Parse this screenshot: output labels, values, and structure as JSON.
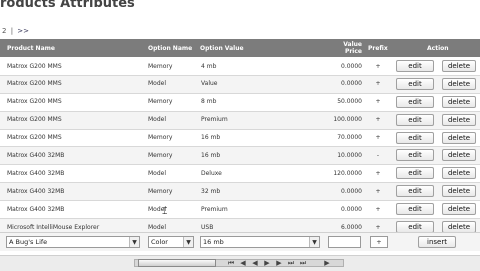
{
  "page": {
    "title": "roducts Attributes"
  },
  "pager": {
    "current": "2",
    "separator": "|",
    "next": ">>"
  },
  "table": {
    "headers": {
      "product_name": "Product Name",
      "option_name": "Option Name",
      "option_value": "Option Value",
      "value_price_line1": "Value",
      "value_price_line2": "Price",
      "prefix": "Prefix",
      "action": "Action"
    },
    "edit_label": "edit",
    "delete_label": "delete",
    "rows": [
      {
        "product": "Matrox G200 MMS",
        "option": "Memory",
        "value": "4 mb",
        "price": "0.0000",
        "prefix": "+"
      },
      {
        "product": "Matrox G200 MMS",
        "option": "Model",
        "value": "Value",
        "price": "0.0000",
        "prefix": "+"
      },
      {
        "product": "Matrox G200 MMS",
        "option": "Memory",
        "value": "8 mb",
        "price": "50.0000",
        "prefix": "+"
      },
      {
        "product": "Matrox G200 MMS",
        "option": "Model",
        "value": "Premium",
        "price": "100.0000",
        "prefix": "+"
      },
      {
        "product": "Matrox G200 MMS",
        "option": "Memory",
        "value": "16 mb",
        "price": "70.0000",
        "prefix": "+"
      },
      {
        "product": "Matrox G400 32MB",
        "option": "Memory",
        "value": "16 mb",
        "price": "10.0000",
        "prefix": "-"
      },
      {
        "product": "Matrox G400 32MB",
        "option": "Model",
        "value": "Deluxe",
        "price": "120.0000",
        "prefix": "+"
      },
      {
        "product": "Matrox G400 32MB",
        "option": "Memory",
        "value": "32 mb",
        "price": "0.0000",
        "prefix": "+"
      },
      {
        "product": "Matrox G400 32MB",
        "option": "Model",
        "value": "Premium",
        "price": "0.0000",
        "prefix": "+"
      },
      {
        "product": "Microsoft IntelliMouse Explorer",
        "option": "Model",
        "value": "USB",
        "price": "6.0000",
        "prefix": "+"
      }
    ]
  },
  "add_row": {
    "product_select": "A Bug's Life",
    "option_select": "Color",
    "value_select": "16 mb",
    "price_value": "",
    "prefix_value": "+",
    "insert_label": "insert"
  }
}
